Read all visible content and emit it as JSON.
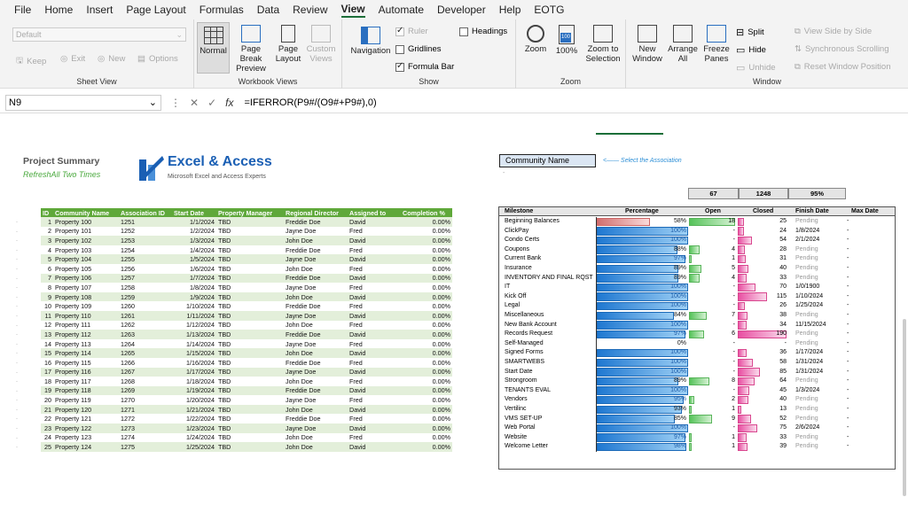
{
  "menu": {
    "items": [
      "File",
      "Home",
      "Insert",
      "Page Layout",
      "Formulas",
      "Data",
      "Review",
      "View",
      "Automate",
      "Developer",
      "Help",
      "EOTG"
    ],
    "active": "View"
  },
  "ribbon": {
    "sheet_view": {
      "label": "Sheet View",
      "dropdown": "Default",
      "keep": "Keep",
      "exit": "Exit",
      "new": "New",
      "options": "Options"
    },
    "workbook_views": {
      "label": "Workbook Views",
      "normal": "Normal",
      "page_break": "Page Break Preview",
      "page_layout": "Page Layout",
      "custom": "Custom Views"
    },
    "show": {
      "label": "Show",
      "navigation": "Navigation",
      "ruler": "Ruler",
      "gridlines": "Gridlines",
      "formula_bar": "Formula Bar",
      "headings": "Headings"
    },
    "zoom": {
      "label": "Zoom",
      "zoom": "Zoom",
      "hundred": "100%",
      "zoom_sel": "Zoom to Selection",
      "hundred_icon": "100"
    },
    "window": {
      "label": "Window",
      "new_window": "New Window",
      "arrange_all": "Arrange All",
      "freeze": "Freeze Panes",
      "split": "Split",
      "hide": "Hide",
      "unhide": "Unhide",
      "side_by_side": "View Side by Side",
      "sync_scroll": "Synchronous Scrolling",
      "reset_pos": "Reset Window Position"
    }
  },
  "formula_bar": {
    "cell": "N9",
    "formula": "=IFERROR(P9#/(O9#+P9#),0)"
  },
  "summary": {
    "title": "Project Summary",
    "subtitle": "RefreshAll Two Times",
    "logo_main": "Excel & Access",
    "logo_sub": "Microsoft Excel and Access Experts"
  },
  "property_table": {
    "headers": [
      "ID",
      "Community Name",
      "Association ID",
      "Start Date",
      "Property Manager",
      "Regional Director",
      "Assigned to",
      "Completion %"
    ],
    "rows": [
      [
        "1",
        "Property 100",
        "1251",
        "1/1/2024",
        "TBD",
        "Freddie Doe",
        "David",
        "0.00%"
      ],
      [
        "2",
        "Property 101",
        "1252",
        "1/2/2024",
        "TBD",
        "Jayne Doe",
        "Fred",
        "0.00%"
      ],
      [
        "3",
        "Property 102",
        "1253",
        "1/3/2024",
        "TBD",
        "John Doe",
        "David",
        "0.00%"
      ],
      [
        "4",
        "Property 103",
        "1254",
        "1/4/2024",
        "TBD",
        "Freddie Doe",
        "Fred",
        "0.00%"
      ],
      [
        "5",
        "Property 104",
        "1255",
        "1/5/2024",
        "TBD",
        "Jayne Doe",
        "David",
        "0.00%"
      ],
      [
        "6",
        "Property 105",
        "1256",
        "1/6/2024",
        "TBD",
        "John Doe",
        "Fred",
        "0.00%"
      ],
      [
        "7",
        "Property 106",
        "1257",
        "1/7/2024",
        "TBD",
        "Freddie Doe",
        "David",
        "0.00%"
      ],
      [
        "8",
        "Property 107",
        "1258",
        "1/8/2024",
        "TBD",
        "Jayne Doe",
        "Fred",
        "0.00%"
      ],
      [
        "9",
        "Property 108",
        "1259",
        "1/9/2024",
        "TBD",
        "John Doe",
        "David",
        "0.00%"
      ],
      [
        "10",
        "Property 109",
        "1260",
        "1/10/2024",
        "TBD",
        "Freddie Doe",
        "Fred",
        "0.00%"
      ],
      [
        "11",
        "Property 110",
        "1261",
        "1/11/2024",
        "TBD",
        "Jayne Doe",
        "David",
        "0.00%"
      ],
      [
        "12",
        "Property 111",
        "1262",
        "1/12/2024",
        "TBD",
        "John Doe",
        "Fred",
        "0.00%"
      ],
      [
        "13",
        "Property 112",
        "1263",
        "1/13/2024",
        "TBD",
        "Freddie Doe",
        "David",
        "0.00%"
      ],
      [
        "14",
        "Property 113",
        "1264",
        "1/14/2024",
        "TBD",
        "Jayne Doe",
        "Fred",
        "0.00%"
      ],
      [
        "15",
        "Property 114",
        "1265",
        "1/15/2024",
        "TBD",
        "John Doe",
        "David",
        "0.00%"
      ],
      [
        "16",
        "Property 115",
        "1266",
        "1/16/2024",
        "TBD",
        "Freddie Doe",
        "Fred",
        "0.00%"
      ],
      [
        "17",
        "Property 116",
        "1267",
        "1/17/2024",
        "TBD",
        "Jayne Doe",
        "David",
        "0.00%"
      ],
      [
        "18",
        "Property 117",
        "1268",
        "1/18/2024",
        "TBD",
        "John Doe",
        "Fred",
        "0.00%"
      ],
      [
        "19",
        "Property 118",
        "1269",
        "1/19/2024",
        "TBD",
        "Freddie Doe",
        "David",
        "0.00%"
      ],
      [
        "20",
        "Property 119",
        "1270",
        "1/20/2024",
        "TBD",
        "Jayne Doe",
        "Fred",
        "0.00%"
      ],
      [
        "21",
        "Property 120",
        "1271",
        "1/21/2024",
        "TBD",
        "John Doe",
        "David",
        "0.00%"
      ],
      [
        "22",
        "Property 121",
        "1272",
        "1/22/2024",
        "TBD",
        "Freddie Doe",
        "Fred",
        "0.00%"
      ],
      [
        "23",
        "Property 122",
        "1273",
        "1/23/2024",
        "TBD",
        "Jayne Doe",
        "David",
        "0.00%"
      ],
      [
        "24",
        "Property 123",
        "1274",
        "1/24/2024",
        "TBD",
        "John Doe",
        "Fred",
        "0.00%"
      ],
      [
        "25",
        "Property 124",
        "1275",
        "1/25/2024",
        "TBD",
        "John Doe",
        "David",
        "0.00%"
      ]
    ]
  },
  "community": {
    "label": "Community Name",
    "hint": "<—— Select the Association",
    "dash": "-"
  },
  "totals": {
    "open": "67",
    "closed": "1248",
    "pct": "95%"
  },
  "milestones": {
    "headers": {
      "milestone": "Milestone",
      "percentage": "Percentage",
      "open": "Open",
      "closed": "Closed",
      "finish": "Finish Date",
      "max": "Max Date"
    },
    "rows": [
      {
        "name": "Beginning Balances",
        "pct": 58,
        "pct_label": "58%",
        "open": "18",
        "open_n": 18,
        "closed": "25",
        "closed_n": 25,
        "finish": "Pending",
        "max": "-",
        "red": true
      },
      {
        "name": "ClickPay",
        "pct": 100,
        "pct_label": "100%",
        "open": "-",
        "open_n": 0,
        "closed": "24",
        "closed_n": 24,
        "finish": "1/8/2024",
        "max": "-"
      },
      {
        "name": "Condo Certs",
        "pct": 100,
        "pct_label": "100%",
        "open": "-",
        "open_n": 0,
        "closed": "54",
        "closed_n": 54,
        "finish": "2/1/2024",
        "max": "-"
      },
      {
        "name": "Coupons",
        "pct": 88,
        "pct_label": "88%",
        "open": "4",
        "open_n": 4,
        "closed": "28",
        "closed_n": 28,
        "finish": "Pending",
        "max": "-"
      },
      {
        "name": "Current Bank",
        "pct": 97,
        "pct_label": "97%",
        "open": "1",
        "open_n": 1,
        "closed": "31",
        "closed_n": 31,
        "finish": "Pending",
        "max": "-"
      },
      {
        "name": "Insurance",
        "pct": 89,
        "pct_label": "89%",
        "open": "5",
        "open_n": 5,
        "closed": "40",
        "closed_n": 40,
        "finish": "Pending",
        "max": "-"
      },
      {
        "name": "INVENTORY AND FINAL RQST",
        "pct": 89,
        "pct_label": "89%",
        "open": "4",
        "open_n": 4,
        "closed": "33",
        "closed_n": 33,
        "finish": "Pending",
        "max": "-"
      },
      {
        "name": "IT",
        "pct": 100,
        "pct_label": "100%",
        "open": "-",
        "open_n": 0,
        "closed": "70",
        "closed_n": 70,
        "finish": "1/0/1900",
        "max": "-"
      },
      {
        "name": "Kick Off",
        "pct": 100,
        "pct_label": "100%",
        "open": "-",
        "open_n": 0,
        "closed": "115",
        "closed_n": 115,
        "finish": "1/10/2024",
        "max": "-"
      },
      {
        "name": "Legal",
        "pct": 100,
        "pct_label": "100%",
        "open": "-",
        "open_n": 0,
        "closed": "26",
        "closed_n": 26,
        "finish": "1/25/2024",
        "max": "-"
      },
      {
        "name": "Miscellaneous",
        "pct": 84,
        "pct_label": "84%",
        "open": "7",
        "open_n": 7,
        "closed": "38",
        "closed_n": 38,
        "finish": "Pending",
        "max": "-"
      },
      {
        "name": "New Bank Account",
        "pct": 100,
        "pct_label": "100%",
        "open": "-",
        "open_n": 0,
        "closed": "34",
        "closed_n": 34,
        "finish": "11/15/2024",
        "max": "-"
      },
      {
        "name": "Records Request",
        "pct": 97,
        "pct_label": "97%",
        "open": "6",
        "open_n": 6,
        "closed": "190",
        "closed_n": 190,
        "finish": "Pending",
        "max": "-"
      },
      {
        "name": "Self-Managed",
        "pct": 0,
        "pct_label": "0%",
        "open": "-",
        "open_n": 0,
        "closed": "-",
        "closed_n": 0,
        "finish": "Pending",
        "max": "-"
      },
      {
        "name": "Signed Forms",
        "pct": 100,
        "pct_label": "100%",
        "open": "-",
        "open_n": 0,
        "closed": "36",
        "closed_n": 36,
        "finish": "1/17/2024",
        "max": "-"
      },
      {
        "name": "SMARTWEBS",
        "pct": 100,
        "pct_label": "100%",
        "open": "-",
        "open_n": 0,
        "closed": "58",
        "closed_n": 58,
        "finish": "1/31/2024",
        "max": "-"
      },
      {
        "name": "Start Date",
        "pct": 100,
        "pct_label": "100%",
        "open": "-",
        "open_n": 0,
        "closed": "85",
        "closed_n": 85,
        "finish": "1/31/2024",
        "max": "-"
      },
      {
        "name": "Strongroom",
        "pct": 89,
        "pct_label": "89%",
        "open": "8",
        "open_n": 8,
        "closed": "64",
        "closed_n": 64,
        "finish": "Pending",
        "max": "-"
      },
      {
        "name": "TENANTS EVAL",
        "pct": 100,
        "pct_label": "100%",
        "open": "-",
        "open_n": 0,
        "closed": "45",
        "closed_n": 45,
        "finish": "1/3/2024",
        "max": "-"
      },
      {
        "name": "Vendors",
        "pct": 95,
        "pct_label": "95%",
        "open": "2",
        "open_n": 2,
        "closed": "40",
        "closed_n": 40,
        "finish": "Pending",
        "max": "-"
      },
      {
        "name": "Vertilinc",
        "pct": 93,
        "pct_label": "93%",
        "open": "1",
        "open_n": 1,
        "closed": "13",
        "closed_n": 13,
        "finish": "Pending",
        "max": "-"
      },
      {
        "name": "VMS SET-UP",
        "pct": 85,
        "pct_label": "85%",
        "open": "9",
        "open_n": 9,
        "closed": "52",
        "closed_n": 52,
        "finish": "Pending",
        "max": "-"
      },
      {
        "name": "Web Portal",
        "pct": 100,
        "pct_label": "100%",
        "open": "-",
        "open_n": 0,
        "closed": "75",
        "closed_n": 75,
        "finish": "2/6/2024",
        "max": "-"
      },
      {
        "name": "Website",
        "pct": 97,
        "pct_label": "97%",
        "open": "1",
        "open_n": 1,
        "closed": "33",
        "closed_n": 33,
        "finish": "Pending",
        "max": "-"
      },
      {
        "name": "Welcome Letter",
        "pct": 98,
        "pct_label": "98%",
        "open": "1",
        "open_n": 1,
        "closed": "39",
        "closed_n": 39,
        "finish": "Pending",
        "max": "-"
      }
    ]
  },
  "colors": {
    "table_header": "#5fa83a",
    "alt_row": "#e3efda",
    "pct_bar": "#1f78d1",
    "open_bar": "#56c35a",
    "closed_bar": "#e84fa2",
    "accent": "#1b6e38"
  }
}
